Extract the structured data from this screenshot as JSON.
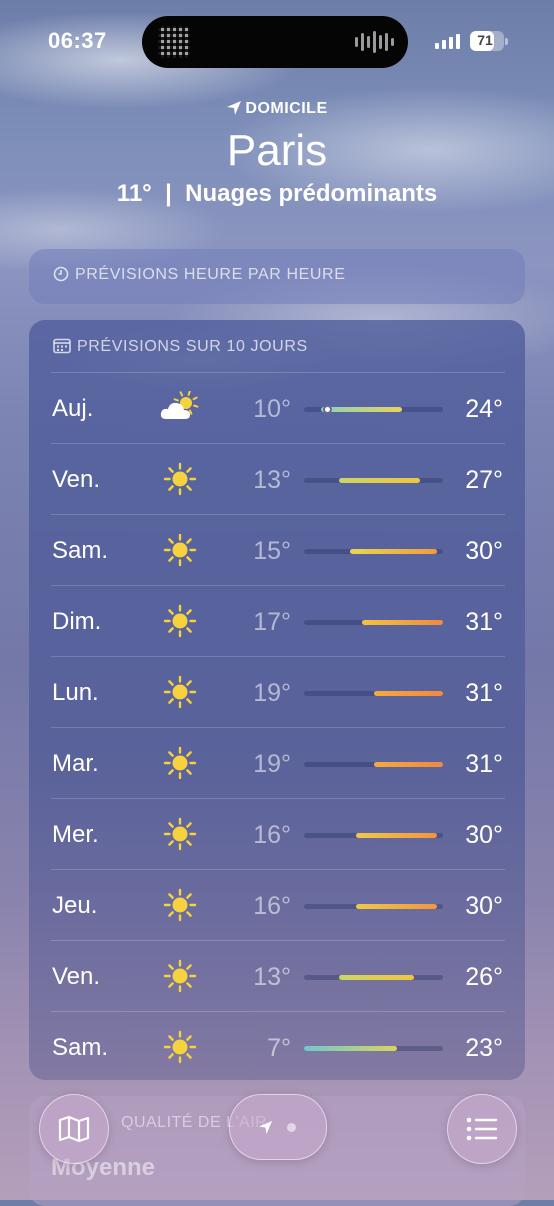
{
  "status": {
    "time": "06:37",
    "battery": "71",
    "battery_level": 0.71
  },
  "header": {
    "location_label": "DOMICILE",
    "city": "Paris",
    "condition": "11°  |  Nuages prédominants"
  },
  "hourly": {
    "title": "PRÉVISIONS HEURE PAR HEURE"
  },
  "ten_day": {
    "title": "PRÉVISIONS SUR 10 JOURS",
    "range_scale": [
      7,
      31
    ],
    "days": [
      {
        "day": "Auj.",
        "icon": "partly-sunny-icon",
        "low": "10°",
        "high": "24°",
        "low_val": 10,
        "high_val": 24,
        "current_val": 11,
        "bar": [
          "#8fd0bf",
          "#e7d35a"
        ]
      },
      {
        "day": "Ven.",
        "icon": "sun-icon",
        "low": "13°",
        "high": "27°",
        "low_val": 13,
        "high_val": 27,
        "bar": [
          "#c9d765",
          "#f3c43c"
        ]
      },
      {
        "day": "Sam.",
        "icon": "sun-icon",
        "low": "15°",
        "high": "30°",
        "low_val": 15,
        "high_val": 30,
        "bar": [
          "#e9d64e",
          "#f29a3f"
        ]
      },
      {
        "day": "Dim.",
        "icon": "sun-icon",
        "low": "17°",
        "high": "31°",
        "low_val": 17,
        "high_val": 31,
        "bar": [
          "#f2c33e",
          "#f2893f"
        ]
      },
      {
        "day": "Lun.",
        "icon": "sun-icon",
        "low": "19°",
        "high": "31°",
        "low_val": 19,
        "high_val": 31,
        "bar": [
          "#f4aa3f",
          "#f2883f"
        ]
      },
      {
        "day": "Mar.",
        "icon": "sun-icon",
        "low": "19°",
        "high": "31°",
        "low_val": 19,
        "high_val": 31,
        "bar": [
          "#f4aa3f",
          "#f2883f"
        ]
      },
      {
        "day": "Mer.",
        "icon": "sun-icon",
        "low": "16°",
        "high": "30°",
        "low_val": 16,
        "high_val": 30,
        "bar": [
          "#eec947",
          "#f2943f"
        ]
      },
      {
        "day": "Jeu.",
        "icon": "sun-icon",
        "low": "16°",
        "high": "30°",
        "low_val": 16,
        "high_val": 30,
        "bar": [
          "#eec947",
          "#f2943f"
        ]
      },
      {
        "day": "Ven.",
        "icon": "sun-icon",
        "low": "13°",
        "high": "26°",
        "low_val": 13,
        "high_val": 26,
        "bar": [
          "#c9d765",
          "#f3c43c"
        ]
      },
      {
        "day": "Sam.",
        "icon": "sun-icon",
        "low": "7°",
        "high": "23°",
        "low_val": 7,
        "high_val": 23,
        "bar": [
          "#6fc7cf",
          "#d9d55a"
        ]
      }
    ]
  },
  "air_quality": {
    "title": "QUALITÉ DE L'AIR",
    "value": "Moyenne"
  },
  "toolbar": {
    "map": "map-icon",
    "location": "location-arrow-icon",
    "list": "list-icon"
  },
  "colors": {
    "sun": "#f7d23f",
    "text_dim": "rgba(255,255,255,0.55)"
  }
}
